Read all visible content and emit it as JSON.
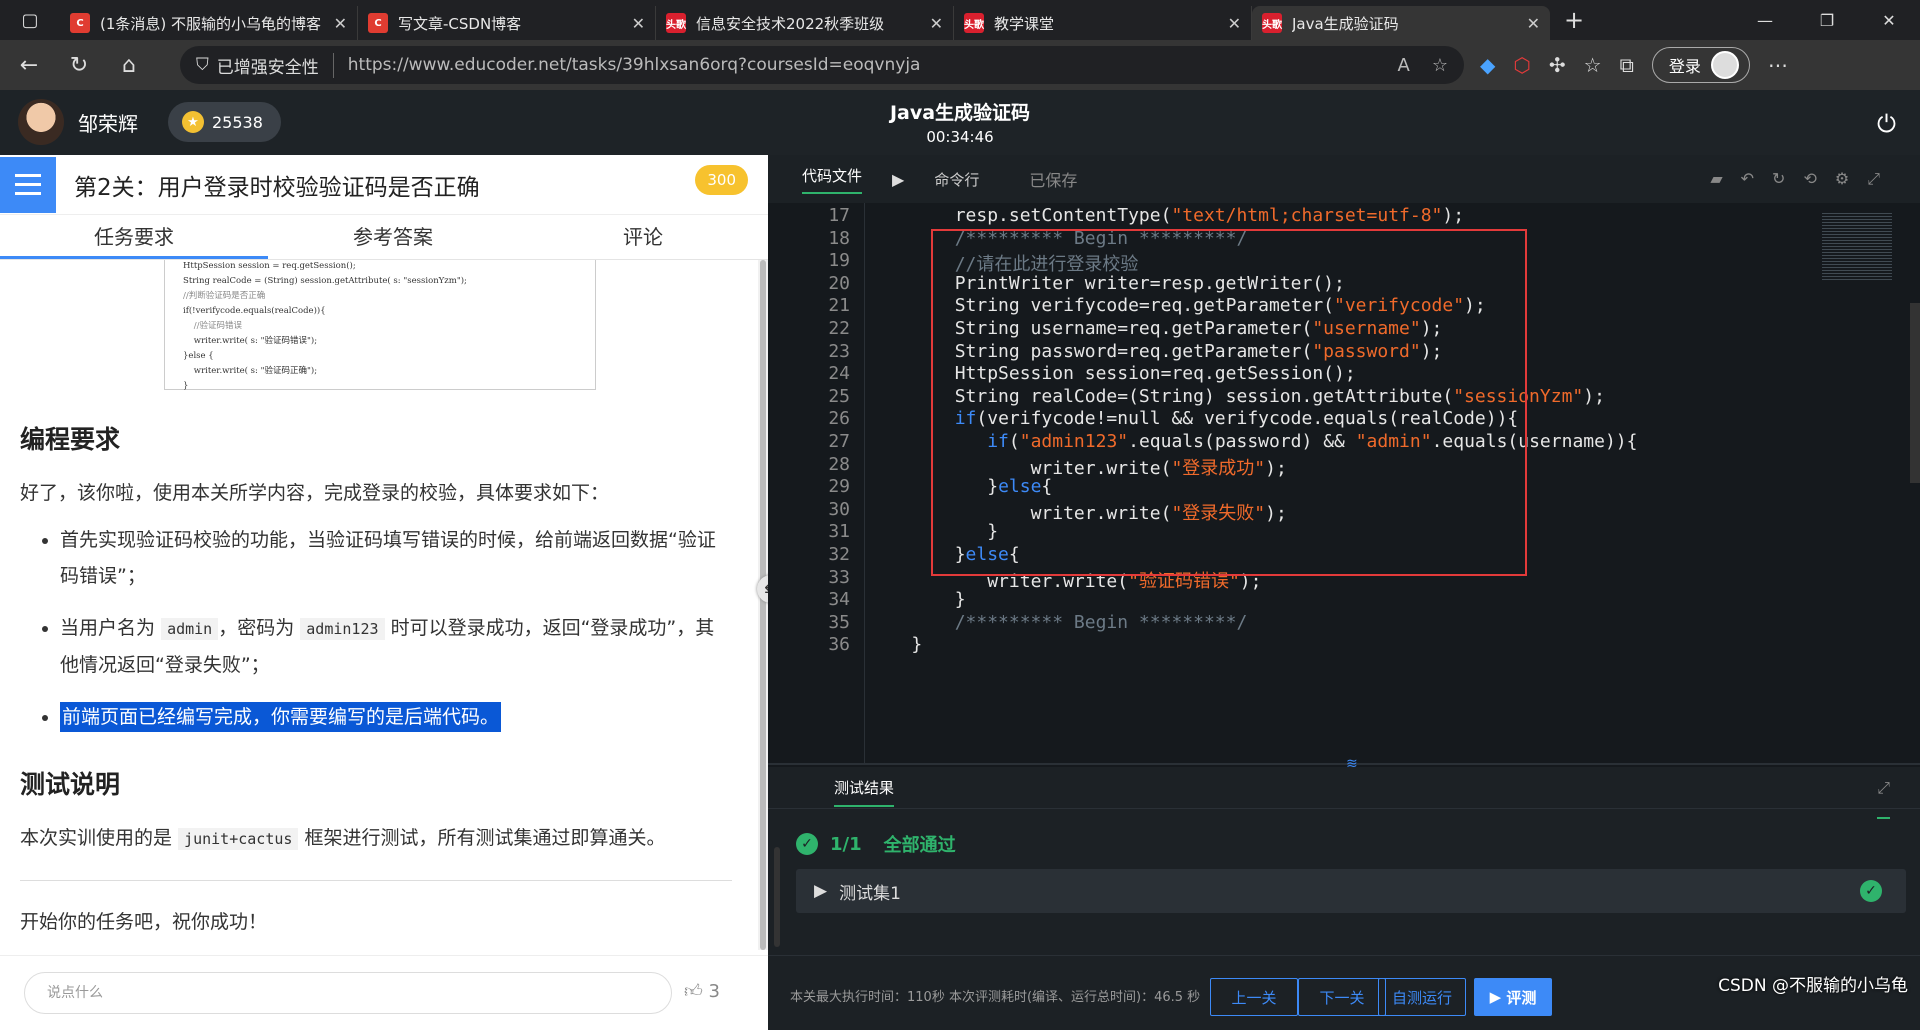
{
  "browser": {
    "tabs": [
      {
        "title": "(1条消息) 不服输的小乌龟的博客",
        "icon": "C",
        "color": "#e03c31"
      },
      {
        "title": "写文章-CSDN博客",
        "icon": "C",
        "color": "#e03c31"
      },
      {
        "title": "信息安全技术2022秋季班级",
        "icon": "头歌",
        "color": "#d9202e"
      },
      {
        "title": "教学课堂",
        "icon": "头歌",
        "color": "#d9202e"
      },
      {
        "title": "Java生成验证码",
        "icon": "头歌",
        "color": "#d9202e"
      }
    ],
    "security_label": "已增强安全性",
    "url": "https://www.educoder.net/tasks/39hlxsan6orq?coursesId=eoqvnyja",
    "login_label": "登录"
  },
  "header": {
    "user_name": "邹荣辉",
    "score": "25538",
    "title": "Java生成验证码",
    "timer": "00:34:46"
  },
  "left": {
    "task_title": "第2关：用户登录时校验验证码是否正确",
    "points": "300",
    "tabs": [
      "任务要求",
      "参考答案",
      "评论"
    ],
    "snippet": [
      "HttpSession session = req.getSession();",
      "String realCode = (String) session.getAttribute( s: \"sessionYzm\");",
      "//判断验证码是否正确",
      "if(!verifycode.equals(realCode)){",
      "    //验证码错误",
      "    writer.write( s: \"验证码错误\");",
      "}else {",
      "    writer.write( s: \"验证码正确\");",
      "}"
    ],
    "section1_title": "编程要求",
    "intro": "好了，该你啦，使用本关所学内容，完成登录的校验，具体要求如下：",
    "req1": "首先实现验证码校验的功能，当验证码填写错误的时候，给前端返回数据“验证码错误”；",
    "req2_a": "当用户名为",
    "req2_code1": "admin",
    "req2_b": "，密码为",
    "req2_code2": "admin123",
    "req2_c": "时可以登录成功，返回“登录成功”，其他情况返回“登录失败”；",
    "req3": "前端页面已经编写完成，你需要编写的是后端代码。",
    "section2_title": "测试说明",
    "test_a": "本次实训使用的是",
    "test_code": "junit+cactus",
    "test_b": "框架进行测试，所有测试集通过即算通关。",
    "start": "开始你的任务吧，祝你成功！",
    "comment_placeholder": "说点什么",
    "likes": "3"
  },
  "editor": {
    "tab_code": "代码文件",
    "tab_cmd": "命令行",
    "saved": "已保存",
    "lines": [
      {
        "n": "17",
        "indent": "        ",
        "parts": [
          [
            "t",
            "resp.setContentType("
          ],
          [
            "s",
            "\"text/html;charset=utf-8\""
          ],
          [
            "t",
            ");"
          ]
        ]
      },
      {
        "n": "18",
        "indent": "        ",
        "parts": [
          [
            "c",
            "/********* Begin *********/"
          ]
        ]
      },
      {
        "n": "19",
        "indent": "        ",
        "parts": [
          [
            "c",
            "//请在此进行登录校验"
          ]
        ]
      },
      {
        "n": "20",
        "indent": "        ",
        "parts": [
          [
            "t",
            "PrintWriter writer=resp.getWriter();"
          ]
        ]
      },
      {
        "n": "21",
        "indent": "        ",
        "parts": [
          [
            "t",
            "String verifycode=req.getParameter("
          ],
          [
            "s",
            "\"verifycode\""
          ],
          [
            "t",
            ");"
          ]
        ]
      },
      {
        "n": "22",
        "indent": "        ",
        "parts": [
          [
            "t",
            "String username=req.getParameter("
          ],
          [
            "s",
            "\"username\""
          ],
          [
            "t",
            ");"
          ]
        ]
      },
      {
        "n": "23",
        "indent": "        ",
        "parts": [
          [
            "t",
            "String password=req.getParameter("
          ],
          [
            "s",
            "\"password\""
          ],
          [
            "t",
            ");"
          ]
        ]
      },
      {
        "n": "24",
        "indent": "        ",
        "parts": [
          [
            "t",
            "HttpSession session=req.getSession();"
          ]
        ]
      },
      {
        "n": "25",
        "indent": "        ",
        "parts": [
          [
            "t",
            "String realCode=(String) session.getAttribute("
          ],
          [
            "s",
            "\"sessionYzm\""
          ],
          [
            "t",
            ");"
          ]
        ]
      },
      {
        "n": "26",
        "indent": "        ",
        "parts": [
          [
            "k",
            "if"
          ],
          [
            "t",
            "(verifycode!=null && verifycode.equals(realCode)){"
          ]
        ]
      },
      {
        "n": "27",
        "indent": "           ",
        "parts": [
          [
            "k",
            "if"
          ],
          [
            "t",
            "("
          ],
          [
            "s",
            "\"admin123\""
          ],
          [
            "t",
            ".equals(password) && "
          ],
          [
            "s",
            "\"admin\""
          ],
          [
            "t",
            ".equals(username)){"
          ]
        ]
      },
      {
        "n": "28",
        "indent": "               ",
        "parts": [
          [
            "t",
            "writer.write("
          ],
          [
            "s",
            "\"登录成功\""
          ],
          [
            "t",
            ");"
          ]
        ]
      },
      {
        "n": "29",
        "indent": "           ",
        "parts": [
          [
            "t",
            "}"
          ],
          [
            "k",
            "else"
          ],
          [
            "t",
            "{"
          ]
        ]
      },
      {
        "n": "30",
        "indent": "               ",
        "parts": [
          [
            "t",
            "writer.write("
          ],
          [
            "s",
            "\"登录失败\""
          ],
          [
            "t",
            ");"
          ]
        ]
      },
      {
        "n": "31",
        "indent": "           ",
        "parts": [
          [
            "t",
            "}"
          ]
        ]
      },
      {
        "n": "32",
        "indent": "        ",
        "parts": [
          [
            "t",
            "}"
          ],
          [
            "k",
            "else"
          ],
          [
            "t",
            "{"
          ]
        ]
      },
      {
        "n": "33",
        "indent": "           ",
        "parts": [
          [
            "t",
            "writer.write("
          ],
          [
            "s",
            "\"验证码错误\""
          ],
          [
            "t",
            ");"
          ]
        ]
      },
      {
        "n": "34",
        "indent": "        ",
        "parts": [
          [
            "t",
            "}"
          ]
        ]
      },
      {
        "n": "35",
        "indent": "        ",
        "parts": [
          [
            "c",
            "/********* Begin *********/"
          ]
        ]
      },
      {
        "n": "36",
        "indent": "    ",
        "parts": [
          [
            "t",
            "}"
          ]
        ]
      }
    ]
  },
  "results": {
    "tab": "测试结果",
    "pass_count": "1/1",
    "pass_text": "全部通过",
    "set_name": "测试集1"
  },
  "footer": {
    "info": "本关最大执行时间：110秒    本次评测耗时(编译、运行总时间)：46.5 秒",
    "prev": "上一关",
    "next": "下一关",
    "self_test": "自测运行",
    "evaluate": "评测",
    "watermark": "CSDN @不服输的小乌龟"
  }
}
